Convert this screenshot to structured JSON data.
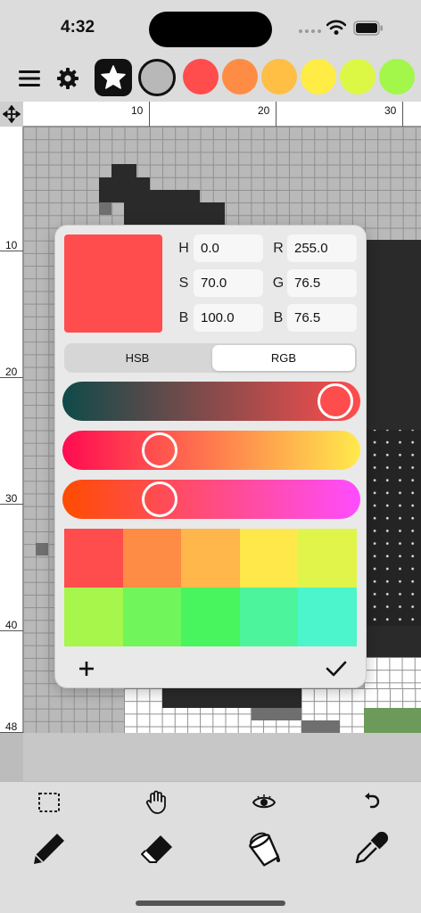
{
  "status": {
    "time": "4:32"
  },
  "toolbar": {
    "swatches": [
      "#ff4c4c",
      "#ff8c44",
      "#ffbe44",
      "#ffec44",
      "#dcf844",
      "#a3f64a"
    ],
    "current_color": "#b8b8b8"
  },
  "rulers": {
    "top": [
      "10",
      "20",
      "30"
    ],
    "left": [
      "10",
      "20",
      "30",
      "40",
      "48"
    ]
  },
  "picker": {
    "preview_color": "#ff4c4c",
    "fields": {
      "h_label": "H",
      "h_value": "0.0",
      "s_label": "S",
      "s_value": "70.0",
      "b_label": "B",
      "b_value": "100.0",
      "r_label": "R",
      "r_value": "255.0",
      "g_label": "G",
      "g_value": "76.5",
      "b2_label": "B",
      "b2_value": "76.5"
    },
    "modes": [
      "HSB",
      "RGB"
    ],
    "active_mode": "RGB",
    "sliders": [
      {
        "gradient": [
          "#0f4a4a",
          "#ff4c4c"
        ],
        "level": 0.98
      },
      {
        "gradient": [
          "#ff0a50",
          "#ffea4c"
        ],
        "level": 0.3
      },
      {
        "gradient": [
          "#ff4c00",
          "#ff4cff"
        ],
        "level": 0.3
      }
    ],
    "palette": [
      "#ff4c4c",
      "#ff8c44",
      "#ffb64a",
      "#ffe84a",
      "#e0f44a",
      "#a6f64c",
      "#70f55a",
      "#48f55e",
      "#4cf59c",
      "#4cf5cc"
    ]
  }
}
